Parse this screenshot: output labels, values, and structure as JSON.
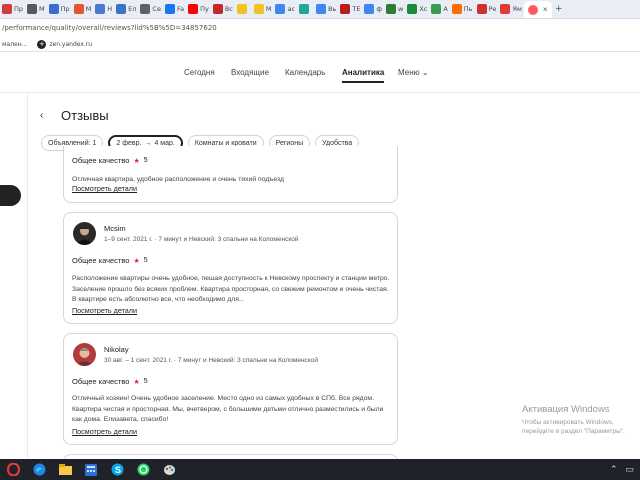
{
  "browser": {
    "tabs": [
      {
        "title": "Пр",
        "icon": "red-square-icon",
        "color": "#d23c3c"
      },
      {
        "title": "М",
        "icon": "gear-dark-icon",
        "color": "#5a5a5a"
      },
      {
        "title": "Пр",
        "icon": "blue-square-icon",
        "color": "#3b6dd1"
      },
      {
        "title": "М",
        "icon": "yandex-y-icon",
        "color": "#e4572e"
      },
      {
        "title": "Н",
        "icon": "bookmark-icon",
        "color": "#4a7bd0"
      },
      {
        "title": "Ел",
        "icon": "vk-icon",
        "color": "#3a75c4"
      },
      {
        "title": "Се",
        "icon": "doc-icon",
        "color": "#5f6368"
      },
      {
        "title": "Fa",
        "icon": "facebook-icon",
        "color": "#1877f2"
      },
      {
        "title": "Пу",
        "icon": "youtube-icon",
        "color": "#ff0000"
      },
      {
        "title": "Вс",
        "icon": "opera-icon",
        "color": "#c62828"
      },
      {
        "title": "",
        "icon": "batman-icon",
        "color": "#f0c420"
      },
      {
        "title": "М",
        "icon": "batman-icon",
        "color": "#f0c420"
      },
      {
        "title": "ас",
        "icon": "google-icon",
        "color": "#4285f4"
      },
      {
        "title": "",
        "icon": "translate-icon",
        "color": "#26a69a"
      },
      {
        "title": "Вь",
        "icon": "google-icon",
        "color": "#4285f4"
      },
      {
        "title": "ТЕ",
        "icon": "bank-icon",
        "color": "#b71c1c"
      },
      {
        "title": "ф",
        "icon": "google-icon",
        "color": "#4285f4"
      },
      {
        "title": "w",
        "icon": "green-square-icon",
        "color": "#2e7d32"
      },
      {
        "title": "Хс",
        "icon": "green-x-icon",
        "color": "#1b8a3a"
      },
      {
        "title": "А",
        "icon": "green-square-icon",
        "color": "#3a9d4b"
      },
      {
        "title": "Пь",
        "icon": "heart-icon",
        "color": "#ff6d00"
      },
      {
        "title": "Ре",
        "icon": "red-circle-icon",
        "color": "#d32f2f"
      },
      {
        "title": "Ям",
        "icon": "maps-pin-icon",
        "color": "#e53935"
      }
    ],
    "active_tab": {
      "icon": "airbnb-icon",
      "color": "#ff5a5f"
    },
    "new_tab": "+",
    "url": "/performance/quality/overall/reviews?lid%5B%5D=34857620",
    "bookmarks": [
      {
        "label": "мален...",
        "icon": ""
      },
      {
        "label": "zen.yandex.ru",
        "icon": "+"
      }
    ]
  },
  "site_nav": {
    "items": [
      "Сегодня",
      "Входящие",
      "Календарь",
      "Аналитика",
      "Меню"
    ],
    "active": "Аналитика",
    "menu_caret": "⌄"
  },
  "page": {
    "back": "‹",
    "title": "Отзывы",
    "filters": {
      "listings": "Объявлений: 1",
      "date_from": "2 февр.",
      "date_arrow": "→",
      "date_to": "4 мар.",
      "rooms": "Комнаты и кровати",
      "regions": "Регионы",
      "amenities": "Удобства"
    }
  },
  "reviews": [
    {
      "quality_label": "Общее качество",
      "star": "★",
      "score": "5",
      "text": "Отличная квартира, удобное расположение и очень тихий подъезд",
      "details": "Посмотреть детали"
    },
    {
      "name": "Mcsim",
      "meta": "1–9 сент. 2021 г. · 7 минут и Невский: 3 спальни на Коломенской",
      "quality_label": "Общее качество",
      "star": "★",
      "score": "5",
      "text": "Расположение квартиры очень удобное, пешая доступность к Невскому проспекту и станции метро. Заселение прошло без всяких проблем. Квартира просторная, со свежим ремонтом и очень чистая. В квартире есть абсолютно все, что необходимо для...",
      "details": "Посмотреть детали"
    },
    {
      "name": "Nikolay",
      "meta": "30 авг. – 1 сент. 2021 г. · 7 минут и Невский: 3 спальни на Коломенской",
      "quality_label": "Общее качество",
      "star": "★",
      "score": "5",
      "text": "Отличный хозяин! Очень удобное заселение. Место одно из самых удобных в СПб. Все рядом. Квартира чистая и просторная. Мы, вчетвером, с большими детьми отлично разместились и были как дома. Елизавета, спасибо!",
      "details": "Посмотреть детали"
    }
  ],
  "windows": {
    "activation_title": "Активация Windows",
    "activation_text": "Чтобы активировать Windows, перейдите в раздел \"Параметры\"."
  },
  "colors": {
    "accent_star": "#e0245e",
    "taskbar": "#1f2228"
  }
}
